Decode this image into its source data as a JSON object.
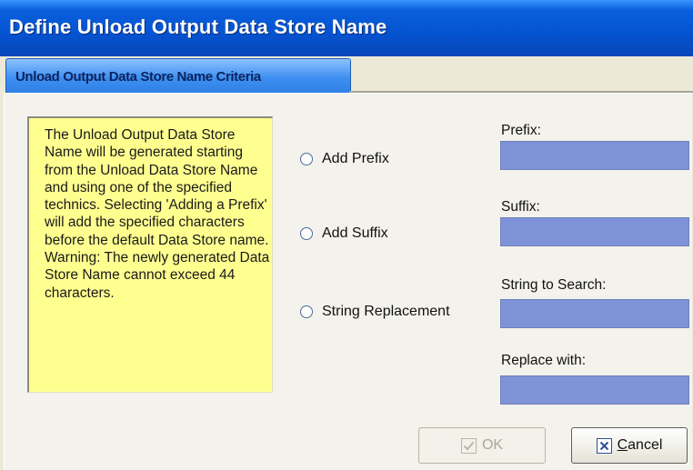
{
  "window": {
    "title": "Define Unload Output Data Store Name"
  },
  "tabs": [
    {
      "label": "Unload Output Data Store Name Criteria"
    }
  ],
  "info": {
    "text": "The Unload Output Data Store Name will be generated starting from the Unload Data Store Name and using one of the specified technics. Selecting 'Adding a Prefix' will add the specified characters before the default Data Store name. Warning: The newly generated Data Store Name cannot exceed 44 characters."
  },
  "options": {
    "prefix": "Add Prefix",
    "suffix": "Add Suffix",
    "replace": "String Replacement"
  },
  "fields": {
    "prefix_label": "Prefix:",
    "prefix_value": "",
    "suffix_label": "Suffix:",
    "suffix_value": "",
    "search_label": "String to Search:",
    "search_value": "",
    "replace_label": "Replace with:",
    "replace_value": ""
  },
  "buttons": {
    "ok": "OK",
    "cancel": "Cancel",
    "cancel_accel": "C",
    "cancel_rest": "ancel"
  },
  "colors": {
    "field": "#7e93d8",
    "note": "#ffff90",
    "titlebar": "#0553d1"
  }
}
